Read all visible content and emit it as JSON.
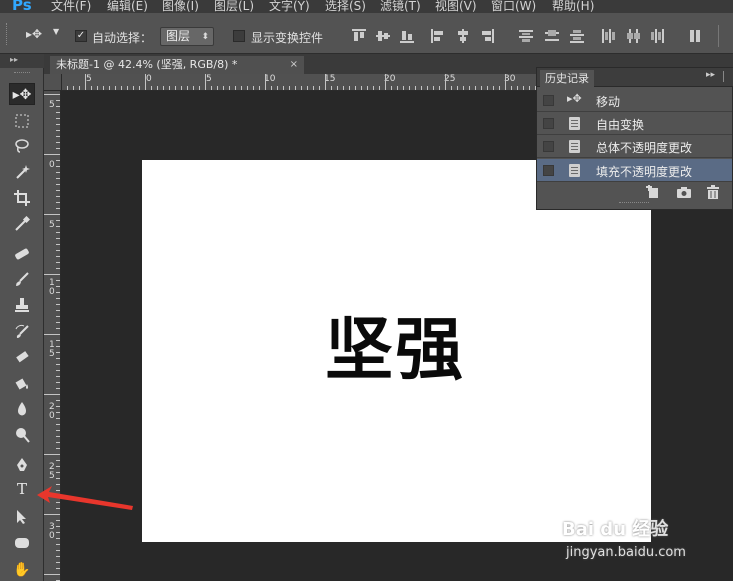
{
  "app": {
    "logo": "Ps"
  },
  "menu": [
    "文件(F)",
    "编辑(E)",
    "图像(I)",
    "图层(L)",
    "文字(Y)",
    "选择(S)",
    "滤镜(T)",
    "视图(V)",
    "窗口(W)",
    "帮助(H)"
  ],
  "options": {
    "auto_select_label": "自动选择：",
    "auto_select_checked": "✓",
    "target_value": "图层",
    "show_transform_label": "显示变换控件"
  },
  "document_tab": {
    "title": "未标题-1 @ 42.4% (坚强, RGB/8) *",
    "close": "×"
  },
  "ruler": {
    "h_labels": [
      "5",
      "0",
      "5",
      "10",
      "15",
      "20",
      "25",
      "30"
    ],
    "v_labels": [
      "5",
      "0",
      "5",
      "1 0",
      "1 5",
      "2 0",
      "2 5",
      "3 0"
    ]
  },
  "canvas": {
    "text": "坚强",
    "zoom": "42.4%"
  },
  "history": {
    "tab_label": "历史记录",
    "items": [
      {
        "label": "移动",
        "icon": "move-icon",
        "selected": false
      },
      {
        "label": "自由变换",
        "icon": "document-icon",
        "selected": false
      },
      {
        "label": "总体不透明度更改",
        "icon": "document-icon",
        "selected": false
      },
      {
        "label": "填充不透明度更改",
        "icon": "document-icon",
        "selected": true
      }
    ]
  },
  "watermark": {
    "brand": "Bai du 经验",
    "url": "jingyan.baidu.com"
  },
  "colors": {
    "accent_selection": "#5a6b85",
    "arrow": "#e8362c",
    "ps_blue": "#31a8ff"
  }
}
